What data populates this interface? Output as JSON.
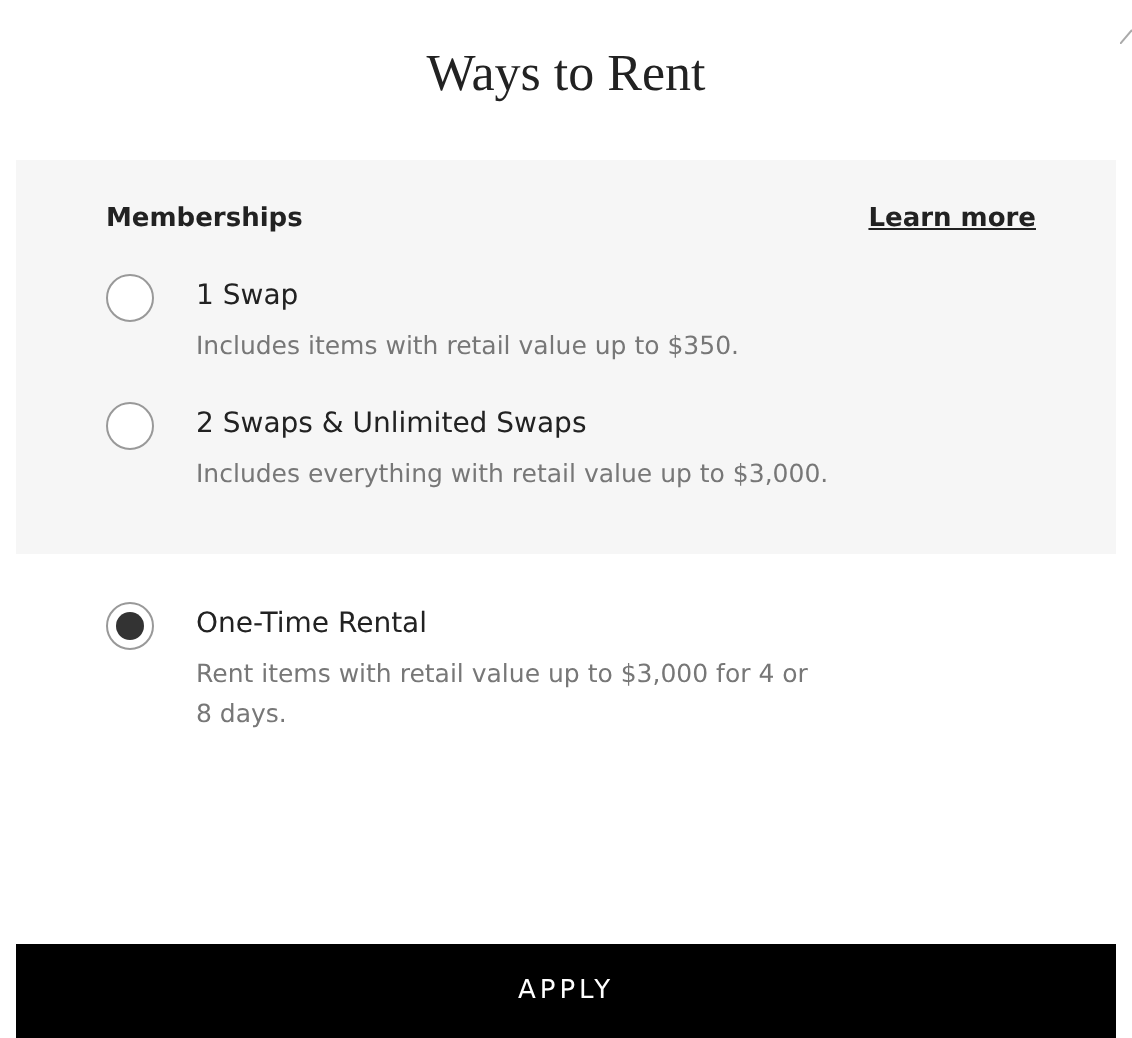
{
  "title": "Ways to Rent",
  "sections": [
    {
      "kind": "shaded",
      "heading": "Memberships",
      "link": "Learn more",
      "options": [
        {
          "label": "1 Swap",
          "description": "Includes items with retail value up to $350.",
          "selected": false
        },
        {
          "label": "2 Swaps & Unlimited Swaps",
          "description": "Includes everything with retail value up to $3,000.",
          "selected": false
        }
      ]
    },
    {
      "kind": "plain",
      "options": [
        {
          "label": "One-Time Rental",
          "description": "Rent items with retail value up to $3,000 for 4 or 8 days.",
          "selected": true
        }
      ]
    }
  ],
  "apply_button": "APPLY"
}
